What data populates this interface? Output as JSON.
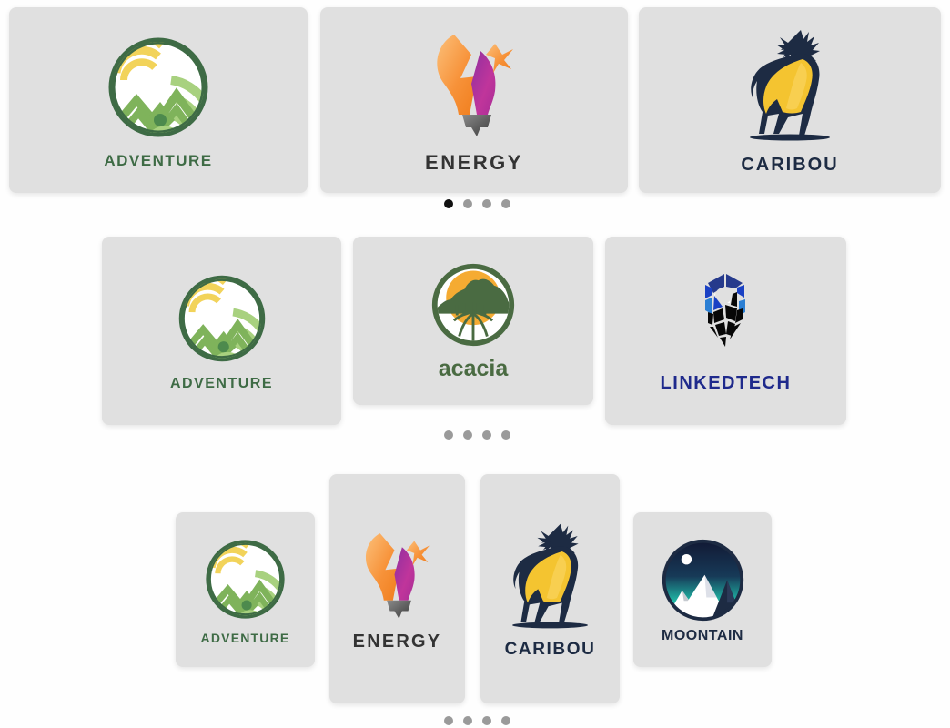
{
  "page": {
    "background_color": "#fefefe",
    "card_color": "#e0e0e0"
  },
  "carousels": [
    {
      "name": "carousel-row-1",
      "layout": "three-wide-landscape",
      "active_dot_index": 0,
      "dot_count": 4,
      "dot_active_color": "#111111",
      "dot_inactive_color": "#9a9a9a",
      "slides": [
        {
          "logo": "adventure-circle-mountain-logo",
          "brand": "ADVENTURE",
          "brand_color": "#3e6b45"
        },
        {
          "logo": "energy-lightbulb-logo",
          "brand": "ENERGY",
          "brand_color": "#333333"
        },
        {
          "logo": "caribou-deer-logo",
          "brand": "CARIBOU",
          "brand_color": "#1d2b43"
        }
      ]
    },
    {
      "name": "carousel-row-2",
      "layout": "three-wide-portrait",
      "active_dot_index": -1,
      "dot_count": 4,
      "dot_active_color": "#111111",
      "dot_inactive_color": "#9a9a9a",
      "slides": [
        {
          "logo": "adventure-circle-mountain-logo",
          "brand": "ADVENTURE",
          "brand_color": "#3e6b45"
        },
        {
          "logo": "acacia-tree-logo",
          "brand": "acacia",
          "brand_color": "#4a6b42"
        },
        {
          "logo": "linkedtech-gem-logo",
          "brand": "LINKEDTECH",
          "brand_color": "#1f2a8c"
        }
      ]
    },
    {
      "name": "carousel-row-3",
      "layout": "four-wide-center-focus",
      "active_dot_index": -1,
      "dot_count": 4,
      "dot_active_color": "#111111",
      "dot_inactive_color": "#9a9a9a",
      "slides": [
        {
          "logo": "adventure-circle-mountain-logo",
          "brand": "ADVENTURE",
          "brand_color": "#3e6b45",
          "size": "small"
        },
        {
          "logo": "energy-lightbulb-logo",
          "brand": "ENERGY",
          "brand_color": "#333333",
          "size": "large"
        },
        {
          "logo": "caribou-deer-logo",
          "brand": "CARIBOU",
          "brand_color": "#1d2b43",
          "size": "large"
        },
        {
          "logo": "moontain-circle-logo",
          "brand": "MOONTAIN",
          "brand_color": "#1d2b43",
          "size": "small"
        }
      ]
    }
  ],
  "palette": {
    "adventure_dark_green": "#3e6b45",
    "adventure_mid_green": "#7fb35b",
    "adventure_light_green": "#a8d17f",
    "adventure_yellow": "#f2d35a",
    "energy_orange": "#f79239",
    "energy_orange_light": "#fbb76b",
    "energy_magenta": "#c0359b",
    "energy_purple": "#8e2fa0",
    "energy_gray": "#6b6b6b",
    "caribou_navy": "#1d2b43",
    "caribou_gold": "#f4c430",
    "acacia_green": "#4a6b42",
    "acacia_orange": "#f5ab32",
    "linkedtech_blue": "#1a41c4",
    "linkedtech_navy": "#263a8c",
    "linkedtech_black": "#070707",
    "moontain_navy": "#1a2340",
    "moontain_teal": "#1fb8a6"
  }
}
